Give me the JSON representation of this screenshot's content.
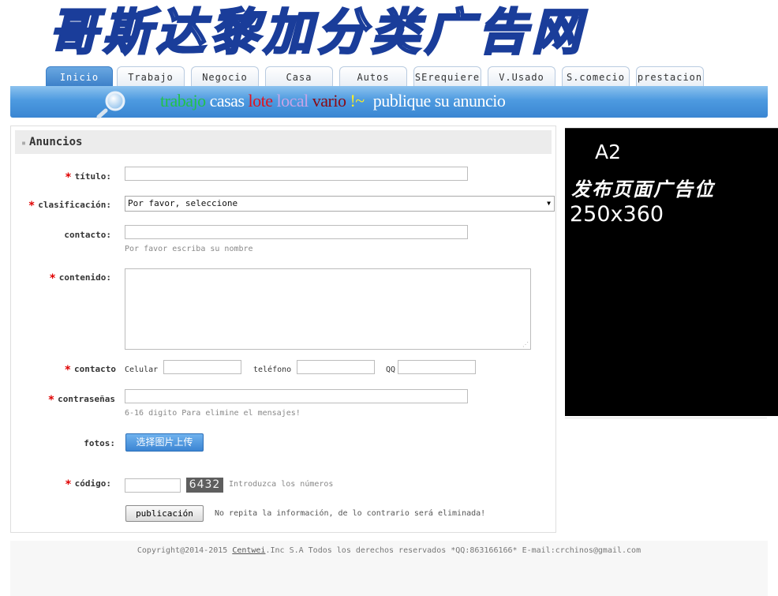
{
  "site": {
    "logo_text": "哥斯达黎加分类广告网"
  },
  "tabs": [
    {
      "label": "Inicio",
      "active": true
    },
    {
      "label": "Trabajo"
    },
    {
      "label": "Negocio"
    },
    {
      "label": "Casa"
    },
    {
      "label": "Autos"
    },
    {
      "label": "SErequiere"
    },
    {
      "label": "V.Usado"
    },
    {
      "label": "S.comecio"
    },
    {
      "label": "prestacion"
    }
  ],
  "banner": {
    "words": [
      {
        "text": "trabajo",
        "color": "#22c24a"
      },
      {
        "text": "casas",
        "color": "#ffffff"
      },
      {
        "text": "lote",
        "color": "#e0141e"
      },
      {
        "text": "local",
        "color": "#c7a4e6"
      },
      {
        "text": "vario",
        "color": "#8a0a14"
      },
      {
        "text": "!~",
        "color": "#ffee22"
      },
      {
        "text": "publique su anuncio",
        "color": "#ffffff"
      }
    ],
    "icon": "search-icon"
  },
  "form": {
    "title": "Anuncios",
    "titulo_label": "título:",
    "clasificacion_label": "clasificación:",
    "clasificacion_value": "Por favor, seleccione",
    "contacto_label": "contacto:",
    "contacto_hint": "Por favor escriba su nombre",
    "contenido_label": "contenido:",
    "contacto2_label": "contacto",
    "celular_label": "Celular",
    "telefono_label": "teléfono",
    "qq_label": "QQ",
    "password_label": "contraseñas",
    "password_hint": "6-16 digito Para elimine el mensajes!",
    "fotos_label": "fotos:",
    "upload_label": "选择图片上传",
    "codigo_label": "código:",
    "captcha_value": "6432",
    "codigo_hint": "Introduzca los números",
    "publish_label": "publicación",
    "publish_hint": "No repita la información, de lo contrario será eliminada!"
  },
  "ad": {
    "line1": "A2",
    "line2": "发布页面广告位",
    "line3": "250x360"
  },
  "footer": {
    "prefix": "Copyright@2014-2015 ",
    "link": "Centwei",
    "suffix": ".Inc S.A Todos los derechos reservados *QQ:863166166* E-mail:crchinos@gmail.com"
  }
}
